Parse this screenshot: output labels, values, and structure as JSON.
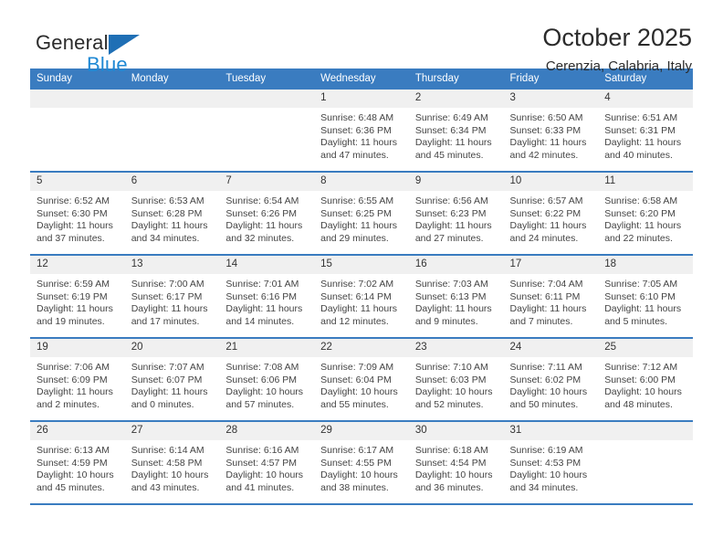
{
  "brand": {
    "name_part1": "General",
    "name_part2": "Blue",
    "triangle_color": "#1f6fb5",
    "blue_color": "#1f88d4"
  },
  "header": {
    "title": "October 2025",
    "subtitle": "Cerenzia, Calabria, Italy"
  },
  "theme": {
    "header_bar_color": "#3a7cc0",
    "daynum_band_color": "#f0f0f0",
    "text_color": "#333333"
  },
  "weekday_headers": [
    "Sunday",
    "Monday",
    "Tuesday",
    "Wednesday",
    "Thursday",
    "Friday",
    "Saturday"
  ],
  "labels": {
    "sunrise_prefix": "Sunrise:",
    "sunset_prefix": "Sunset:",
    "daylight_prefix": "Daylight:"
  },
  "weeks": [
    [
      {
        "day": "",
        "empty": true
      },
      {
        "day": "",
        "empty": true
      },
      {
        "day": "",
        "empty": true
      },
      {
        "day": "1",
        "sunrise": "Sunrise: 6:48 AM",
        "sunset": "Sunset: 6:36 PM",
        "daylight1": "Daylight: 11 hours",
        "daylight2": "and 47 minutes."
      },
      {
        "day": "2",
        "sunrise": "Sunrise: 6:49 AM",
        "sunset": "Sunset: 6:34 PM",
        "daylight1": "Daylight: 11 hours",
        "daylight2": "and 45 minutes."
      },
      {
        "day": "3",
        "sunrise": "Sunrise: 6:50 AM",
        "sunset": "Sunset: 6:33 PM",
        "daylight1": "Daylight: 11 hours",
        "daylight2": "and 42 minutes."
      },
      {
        "day": "4",
        "sunrise": "Sunrise: 6:51 AM",
        "sunset": "Sunset: 6:31 PM",
        "daylight1": "Daylight: 11 hours",
        "daylight2": "and 40 minutes."
      }
    ],
    [
      {
        "day": "5",
        "sunrise": "Sunrise: 6:52 AM",
        "sunset": "Sunset: 6:30 PM",
        "daylight1": "Daylight: 11 hours",
        "daylight2": "and 37 minutes."
      },
      {
        "day": "6",
        "sunrise": "Sunrise: 6:53 AM",
        "sunset": "Sunset: 6:28 PM",
        "daylight1": "Daylight: 11 hours",
        "daylight2": "and 34 minutes."
      },
      {
        "day": "7",
        "sunrise": "Sunrise: 6:54 AM",
        "sunset": "Sunset: 6:26 PM",
        "daylight1": "Daylight: 11 hours",
        "daylight2": "and 32 minutes."
      },
      {
        "day": "8",
        "sunrise": "Sunrise: 6:55 AM",
        "sunset": "Sunset: 6:25 PM",
        "daylight1": "Daylight: 11 hours",
        "daylight2": "and 29 minutes."
      },
      {
        "day": "9",
        "sunrise": "Sunrise: 6:56 AM",
        "sunset": "Sunset: 6:23 PM",
        "daylight1": "Daylight: 11 hours",
        "daylight2": "and 27 minutes."
      },
      {
        "day": "10",
        "sunrise": "Sunrise: 6:57 AM",
        "sunset": "Sunset: 6:22 PM",
        "daylight1": "Daylight: 11 hours",
        "daylight2": "and 24 minutes."
      },
      {
        "day": "11",
        "sunrise": "Sunrise: 6:58 AM",
        "sunset": "Sunset: 6:20 PM",
        "daylight1": "Daylight: 11 hours",
        "daylight2": "and 22 minutes."
      }
    ],
    [
      {
        "day": "12",
        "sunrise": "Sunrise: 6:59 AM",
        "sunset": "Sunset: 6:19 PM",
        "daylight1": "Daylight: 11 hours",
        "daylight2": "and 19 minutes."
      },
      {
        "day": "13",
        "sunrise": "Sunrise: 7:00 AM",
        "sunset": "Sunset: 6:17 PM",
        "daylight1": "Daylight: 11 hours",
        "daylight2": "and 17 minutes."
      },
      {
        "day": "14",
        "sunrise": "Sunrise: 7:01 AM",
        "sunset": "Sunset: 6:16 PM",
        "daylight1": "Daylight: 11 hours",
        "daylight2": "and 14 minutes."
      },
      {
        "day": "15",
        "sunrise": "Sunrise: 7:02 AM",
        "sunset": "Sunset: 6:14 PM",
        "daylight1": "Daylight: 11 hours",
        "daylight2": "and 12 minutes."
      },
      {
        "day": "16",
        "sunrise": "Sunrise: 7:03 AM",
        "sunset": "Sunset: 6:13 PM",
        "daylight1": "Daylight: 11 hours",
        "daylight2": "and 9 minutes."
      },
      {
        "day": "17",
        "sunrise": "Sunrise: 7:04 AM",
        "sunset": "Sunset: 6:11 PM",
        "daylight1": "Daylight: 11 hours",
        "daylight2": "and 7 minutes."
      },
      {
        "day": "18",
        "sunrise": "Sunrise: 7:05 AM",
        "sunset": "Sunset: 6:10 PM",
        "daylight1": "Daylight: 11 hours",
        "daylight2": "and 5 minutes."
      }
    ],
    [
      {
        "day": "19",
        "sunrise": "Sunrise: 7:06 AM",
        "sunset": "Sunset: 6:09 PM",
        "daylight1": "Daylight: 11 hours",
        "daylight2": "and 2 minutes."
      },
      {
        "day": "20",
        "sunrise": "Sunrise: 7:07 AM",
        "sunset": "Sunset: 6:07 PM",
        "daylight1": "Daylight: 11 hours",
        "daylight2": "and 0 minutes."
      },
      {
        "day": "21",
        "sunrise": "Sunrise: 7:08 AM",
        "sunset": "Sunset: 6:06 PM",
        "daylight1": "Daylight: 10 hours",
        "daylight2": "and 57 minutes."
      },
      {
        "day": "22",
        "sunrise": "Sunrise: 7:09 AM",
        "sunset": "Sunset: 6:04 PM",
        "daylight1": "Daylight: 10 hours",
        "daylight2": "and 55 minutes."
      },
      {
        "day": "23",
        "sunrise": "Sunrise: 7:10 AM",
        "sunset": "Sunset: 6:03 PM",
        "daylight1": "Daylight: 10 hours",
        "daylight2": "and 52 minutes."
      },
      {
        "day": "24",
        "sunrise": "Sunrise: 7:11 AM",
        "sunset": "Sunset: 6:02 PM",
        "daylight1": "Daylight: 10 hours",
        "daylight2": "and 50 minutes."
      },
      {
        "day": "25",
        "sunrise": "Sunrise: 7:12 AM",
        "sunset": "Sunset: 6:00 PM",
        "daylight1": "Daylight: 10 hours",
        "daylight2": "and 48 minutes."
      }
    ],
    [
      {
        "day": "26",
        "sunrise": "Sunrise: 6:13 AM",
        "sunset": "Sunset: 4:59 PM",
        "daylight1": "Daylight: 10 hours",
        "daylight2": "and 45 minutes."
      },
      {
        "day": "27",
        "sunrise": "Sunrise: 6:14 AM",
        "sunset": "Sunset: 4:58 PM",
        "daylight1": "Daylight: 10 hours",
        "daylight2": "and 43 minutes."
      },
      {
        "day": "28",
        "sunrise": "Sunrise: 6:16 AM",
        "sunset": "Sunset: 4:57 PM",
        "daylight1": "Daylight: 10 hours",
        "daylight2": "and 41 minutes."
      },
      {
        "day": "29",
        "sunrise": "Sunrise: 6:17 AM",
        "sunset": "Sunset: 4:55 PM",
        "daylight1": "Daylight: 10 hours",
        "daylight2": "and 38 minutes."
      },
      {
        "day": "30",
        "sunrise": "Sunrise: 6:18 AM",
        "sunset": "Sunset: 4:54 PM",
        "daylight1": "Daylight: 10 hours",
        "daylight2": "and 36 minutes."
      },
      {
        "day": "31",
        "sunrise": "Sunrise: 6:19 AM",
        "sunset": "Sunset: 4:53 PM",
        "daylight1": "Daylight: 10 hours",
        "daylight2": "and 34 minutes."
      },
      {
        "day": "",
        "empty": true
      }
    ]
  ]
}
